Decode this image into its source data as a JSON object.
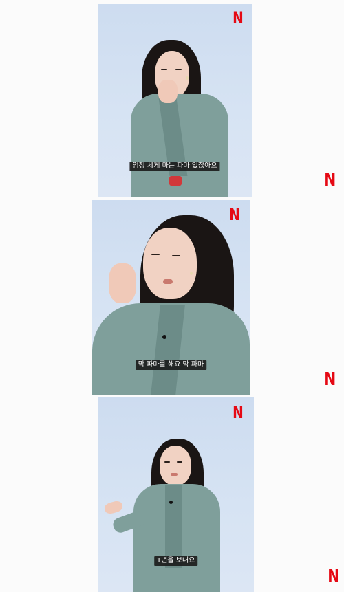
{
  "frames": [
    {
      "subtitle": "엄청 세게 마는 파마 있잖아요",
      "logo": "N"
    },
    {
      "subtitle": "막 파마를 해요 막 파마",
      "logo": "N"
    },
    {
      "subtitle": "1년을 보내요",
      "logo": "N"
    }
  ],
  "side_logos": [
    "N",
    "N",
    "N"
  ],
  "colors": {
    "background": "#cddcf0",
    "jacket": "#7f9f9b",
    "logo": "#e50914",
    "subtitle_bg": "#1c1c1c"
  }
}
